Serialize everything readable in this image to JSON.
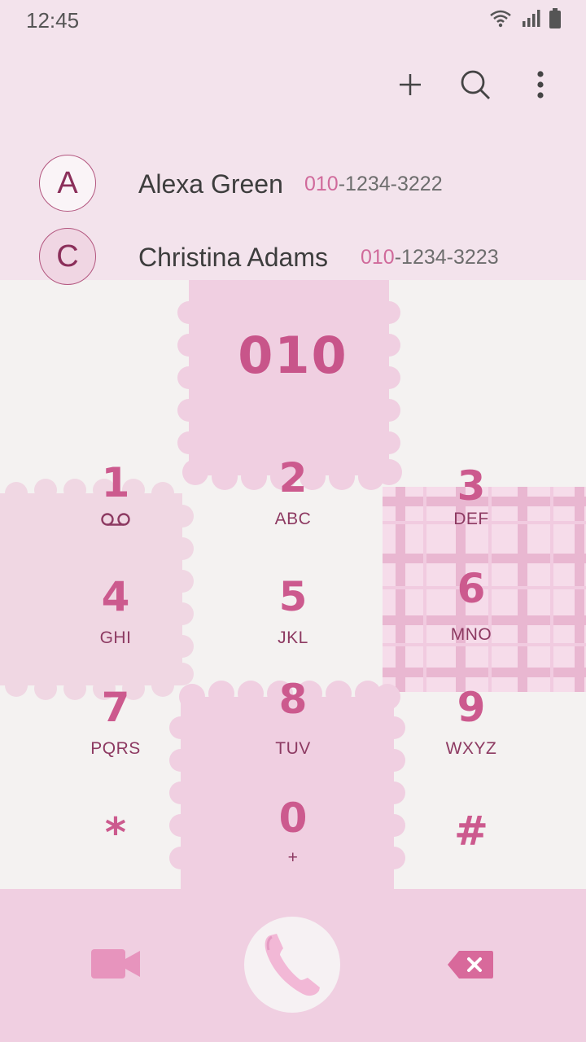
{
  "status": {
    "time": "12:45"
  },
  "toolbar": {
    "add": "add-icon",
    "search": "search-icon",
    "more": "more-icon"
  },
  "contacts": [
    {
      "initial": "A",
      "name": "Alexa Green",
      "num_prefix": "010",
      "num_rest": "-1234-3222"
    },
    {
      "initial": "C",
      "name": "Christina Adams",
      "num_prefix": "010",
      "num_rest": "-1234-3223"
    }
  ],
  "dialed_number": "010",
  "keys": [
    {
      "digit": "1",
      "letters": ""
    },
    {
      "digit": "2",
      "letters": "ABC"
    },
    {
      "digit": "3",
      "letters": "DEF"
    },
    {
      "digit": "4",
      "letters": "GHI"
    },
    {
      "digit": "5",
      "letters": "JKL"
    },
    {
      "digit": "6",
      "letters": "MNO"
    },
    {
      "digit": "7",
      "letters": "PQRS"
    },
    {
      "digit": "8",
      "letters": "TUV"
    },
    {
      "digit": "9",
      "letters": "WXYZ"
    },
    {
      "digit": "*",
      "letters": ""
    },
    {
      "digit": "0",
      "letters": "+"
    },
    {
      "digit": "#",
      "letters": ""
    }
  ],
  "colors": {
    "accent": "#cc5a8e",
    "dark_accent": "#8d3a62",
    "pink_bg": "#f0cfe1",
    "top_bg": "#f3e3ec"
  }
}
